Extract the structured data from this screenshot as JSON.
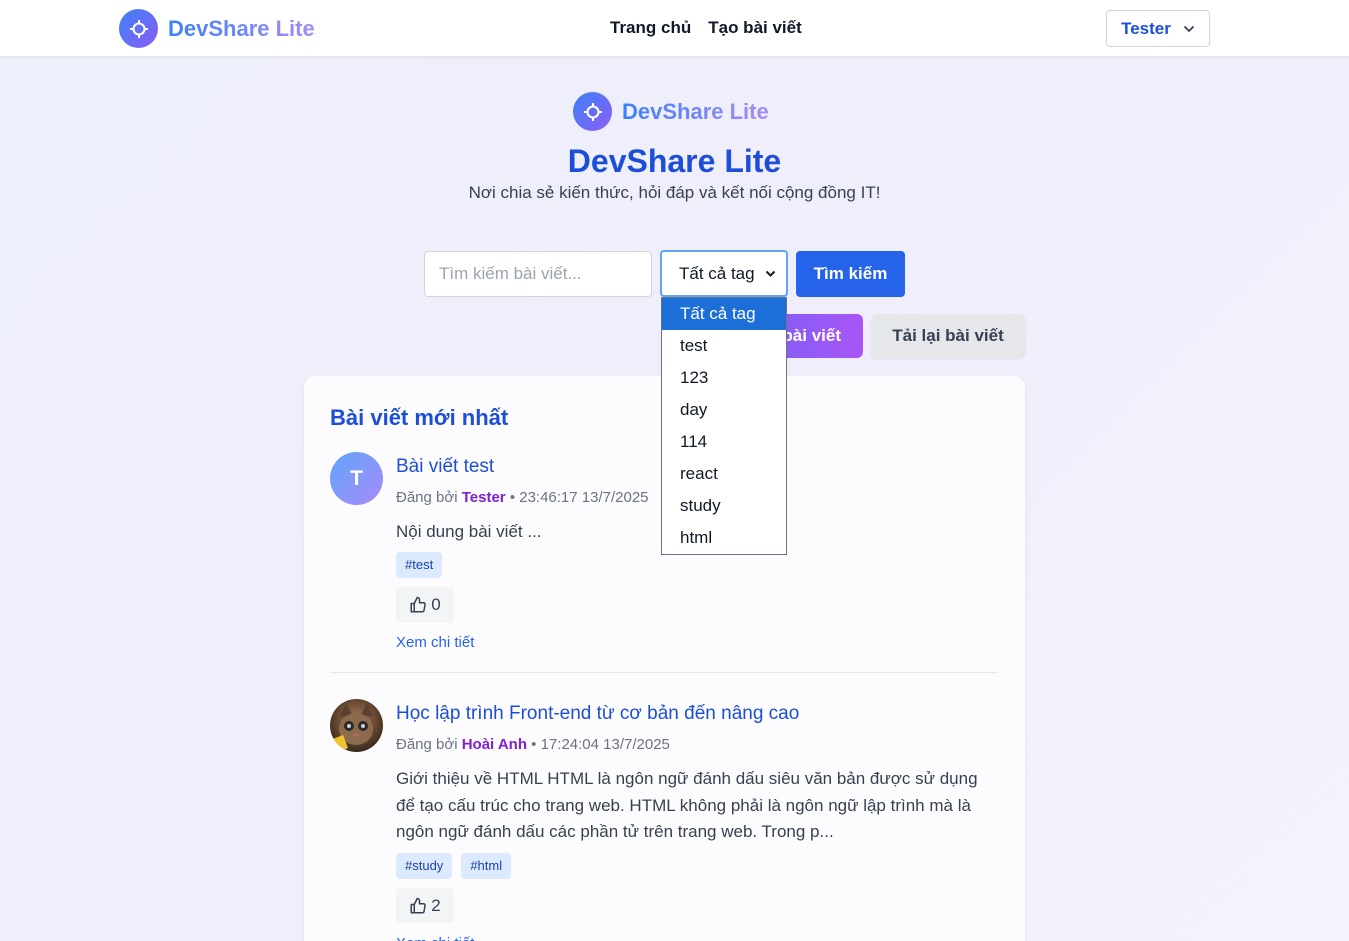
{
  "nav": {
    "brand": "DevShare Lite",
    "links": [
      "Trang chủ",
      "Tạo bài viết"
    ],
    "user": "Tester"
  },
  "hero": {
    "brand": "DevShare Lite",
    "title": "DevShare Lite",
    "subtitle": "Nơi chia sẻ kiến thức, hỏi đáp và kết nối cộng đồng IT!"
  },
  "search": {
    "placeholder": "Tìm kiếm bài viết...",
    "tag_selected": "Tất cả tag",
    "button": "Tìm kiếm",
    "tag_options": [
      "Tất cả tag",
      "test",
      "123",
      "day",
      "114",
      "react",
      "study",
      "html"
    ]
  },
  "actions": {
    "create_partial": "bài viết",
    "reload": "Tải lại bài viết"
  },
  "posts_section": {
    "title": "Bài viết mới nhất",
    "posted_by": "Đăng bởi",
    "detail_link": "Xem chi tiết",
    "posts": [
      {
        "avatar_letter": "T",
        "title": "Bài viết test",
        "author": "Tester",
        "time": "• 23:46:17 13/7/2025",
        "excerpt": "Nội dung bài viết ...",
        "tags": [
          "#test"
        ],
        "likes": "0"
      },
      {
        "avatar_letter": "",
        "title": "Học lập trình Front-end từ cơ bản đến nâng cao",
        "author": "Hoài Anh",
        "time": "• 17:24:04 13/7/2025",
        "excerpt": "Giới thiệu về HTML HTML là ngôn ngữ đánh dấu siêu văn bản được sử dụng để tạo cấu trúc cho trang web. HTML không phải là ngôn ngữ lập trình mà là ngôn ngữ đánh dấu các phần tử trên trang web. Trong p...",
        "tags": [
          "#study",
          "#html"
        ],
        "likes": "2"
      }
    ]
  },
  "colors": {
    "primary": "#2563eb",
    "title_blue": "#1d4ed8",
    "author_purple": "#7e22ce",
    "tag_bg": "#dbeafe"
  }
}
